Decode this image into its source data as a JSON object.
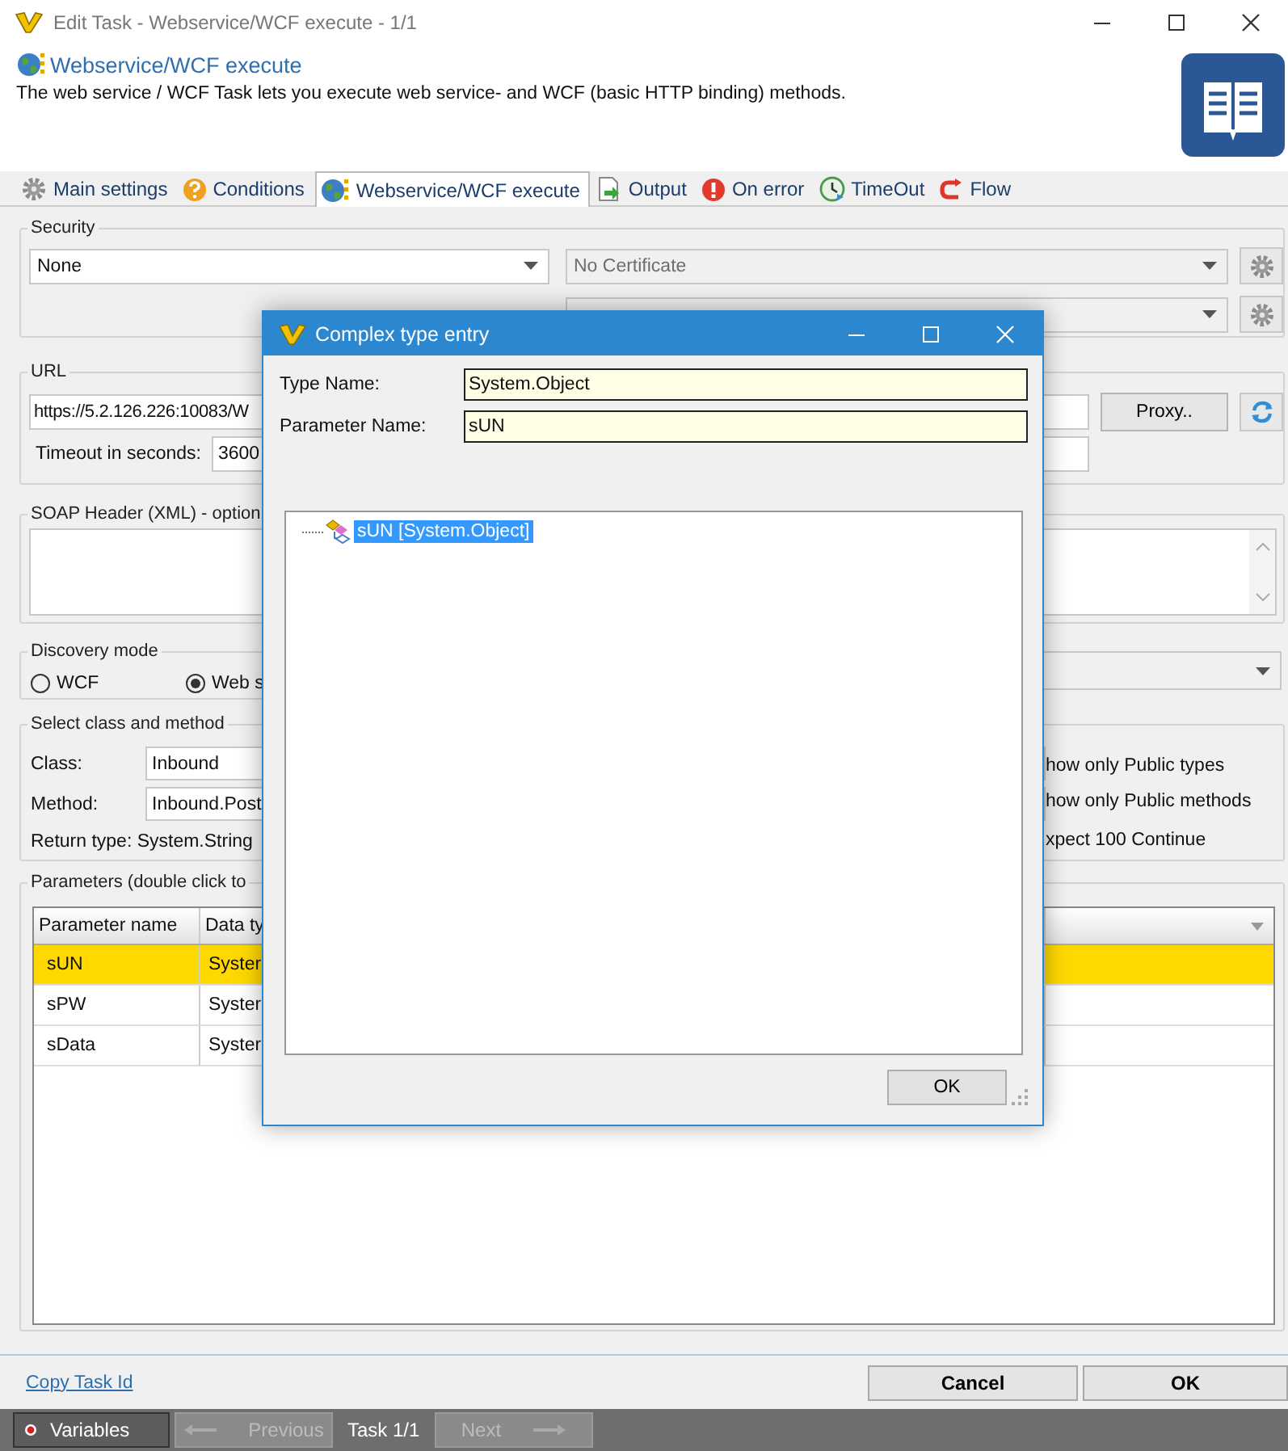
{
  "window": {
    "title": "Edit Task - Webservice/WCF execute - 1/1"
  },
  "header": {
    "title": "Webservice/WCF execute",
    "description": "The web service / WCF Task lets you execute web service- and WCF (basic HTTP binding) methods."
  },
  "tabs": [
    {
      "label": "Main settings",
      "selected": false
    },
    {
      "label": "Conditions",
      "selected": false
    },
    {
      "label": "Webservice/WCF execute",
      "selected": true
    },
    {
      "label": "Output",
      "selected": false
    },
    {
      "label": "On error",
      "selected": false
    },
    {
      "label": "TimeOut",
      "selected": false
    },
    {
      "label": "Flow",
      "selected": false
    }
  ],
  "security": {
    "legend": "Security",
    "mode": "None",
    "certificate": "No Certificate"
  },
  "url": {
    "legend": "URL",
    "value": "https://5.2.126.226:10083/W",
    "proxy_button": "Proxy..",
    "timeout_label": "Timeout in seconds:",
    "timeout": "3600"
  },
  "soap_header": {
    "legend": "SOAP Header (XML) - option"
  },
  "discovery": {
    "legend": "Discovery mode",
    "options": [
      {
        "label": "WCF",
        "selected": false
      },
      {
        "label": "Web s",
        "selected": true
      }
    ]
  },
  "class_method": {
    "legend": "Select class and method",
    "class_label": "Class:",
    "class": "Inbound",
    "method_label": "Method:",
    "method": "Inbound.Post",
    "return_type": "Return type: System.String",
    "options": [
      "how only Public types",
      "how only Public methods",
      "xpect 100 Continue"
    ]
  },
  "parameters": {
    "legend": "Parameters (double click to",
    "columns": [
      "Parameter name",
      "Data ty"
    ],
    "rows": [
      {
        "name": "sUN",
        "type": "Syster",
        "selected": true
      },
      {
        "name": "sPW",
        "type": "Syster",
        "selected": false
      },
      {
        "name": "sData",
        "type": "Syster",
        "selected": false
      }
    ]
  },
  "copy_link": "Copy Task Id",
  "buttons": [
    "Cancel",
    "OK"
  ],
  "footer": {
    "variables": "Variables",
    "previous": {
      "label": "Previous",
      "disabled": true
    },
    "task": "Task 1/1",
    "next": {
      "label": "Next",
      "disabled": true
    }
  },
  "dialog": {
    "title": "Complex type entry",
    "fields": [
      {
        "label": "Type Name:",
        "value": "System.Object"
      },
      {
        "label": "Parameter Name:",
        "value": "sUN"
      }
    ],
    "tree": [
      {
        "label": "sUN [System.Object]",
        "selected": true
      }
    ],
    "ok": "OK"
  }
}
